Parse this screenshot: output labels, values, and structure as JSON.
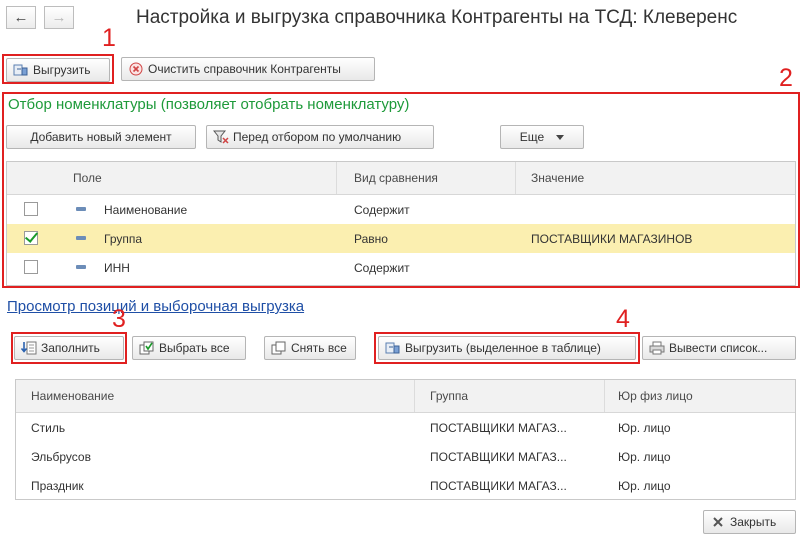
{
  "window": {
    "title": "Настройка и выгрузка справочника Контрагенты на ТСД: Клеверенс"
  },
  "nav": {
    "back_icon": "←",
    "forward_icon": "→"
  },
  "toolbar": {
    "export_label": "Выгрузить",
    "clear_label": "Очистить справочник Контрагенты"
  },
  "annotations": {
    "n1": "1",
    "n2": "2",
    "n3": "3",
    "n4": "4"
  },
  "filter": {
    "title": "Отбор номенклатуры (позволяет отобрать номенклатуру)",
    "add_label": "Добавить новый элемент",
    "default_label": "Перед отбором по умолчанию",
    "more_label": "Еще",
    "columns": {
      "field": "Поле",
      "comparison": "Вид сравнения",
      "value": "Значение"
    },
    "rows": [
      {
        "checked": false,
        "field": "Наименование",
        "comparison": "Содержит",
        "value": ""
      },
      {
        "checked": true,
        "field": "Группа",
        "comparison": "Равно",
        "value": "ПОСТАВЩИКИ МАГАЗИНОВ"
      },
      {
        "checked": false,
        "field": "ИНН",
        "comparison": "Содержит",
        "value": ""
      }
    ]
  },
  "preview": {
    "title": "Просмотр позиций и выборочная выгрузка",
    "fill_label": "Заполнить",
    "select_all_label": "Выбрать все",
    "deselect_all_label": "Снять все",
    "export_selected_label": "Выгрузить (выделенное в таблице)",
    "output_list_label": "Вывести список...",
    "columns": {
      "name": "Наименование",
      "group": "Группа",
      "type": "Юр физ лицо"
    },
    "rows": [
      {
        "name": "Стиль",
        "group": "ПОСТАВЩИКИ МАГАЗ...",
        "type": "Юр. лицо"
      },
      {
        "name": "Эльбрусов",
        "group": "ПОСТАВЩИКИ МАГАЗ...",
        "type": "Юр. лицо"
      },
      {
        "name": "Праздник",
        "group": "ПОСТАВЩИКИ МАГАЗ...",
        "type": "Юр. лицо"
      }
    ]
  },
  "footer": {
    "close_label": "Закрыть"
  },
  "colors": {
    "accent_red": "#e02020",
    "green_title": "#1e9a3a",
    "link_blue": "#1f4fa6",
    "selected_row": "#fbefb0"
  }
}
